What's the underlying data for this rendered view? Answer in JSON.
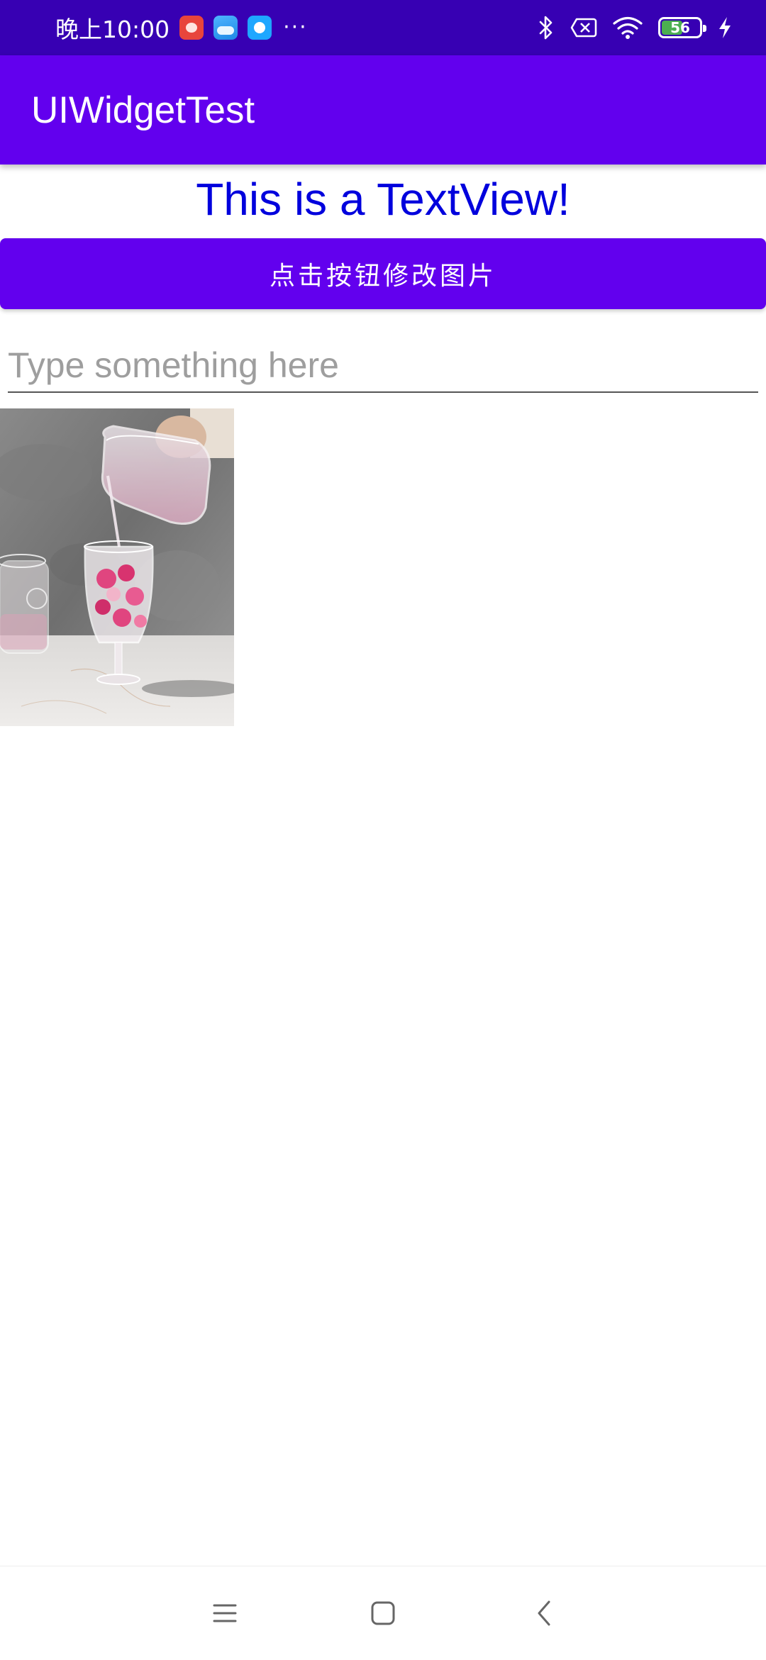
{
  "status_bar": {
    "time": "晚上10:00",
    "more": "···",
    "battery_level": "56",
    "battery_fraction": 0.56,
    "icons": [
      "app-notification-red-icon",
      "weather-app-icon",
      "chat-app-icon",
      "bluetooth-icon",
      "sim-error-icon",
      "wifi-icon",
      "battery-icon",
      "charging-icon"
    ]
  },
  "app_bar": {
    "title": "UIWidgetTest",
    "color": "#6200ee"
  },
  "main": {
    "text_view": "This is a TextView!",
    "button_label": "点击按钮修改图片",
    "input": {
      "value": "",
      "placeholder": "Type something here"
    }
  },
  "nav_bar": {
    "icons": [
      "menu-icon",
      "home-icon",
      "back-icon"
    ]
  },
  "colors": {
    "primary": "#6200ee",
    "primary_dark": "#3700b3",
    "text_view": "#0000dd"
  }
}
